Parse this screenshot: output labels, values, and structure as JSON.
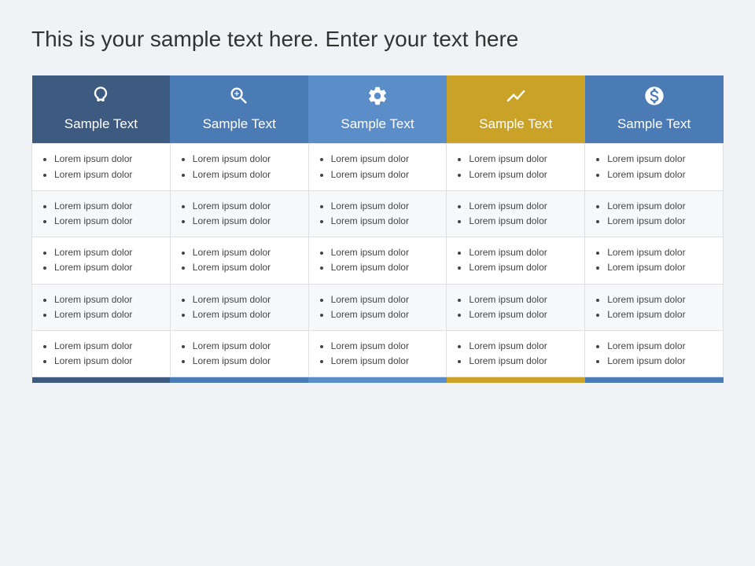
{
  "title": "This is your sample text here. Enter your text here",
  "columns": [
    {
      "id": "col1",
      "label": "Sample Text",
      "icon": "💡",
      "colorClass": "col-1",
      "bottomClass": "bc-1"
    },
    {
      "id": "col2",
      "label": "Sample Text",
      "icon": "🔍",
      "colorClass": "col-2",
      "bottomClass": "bc-2"
    },
    {
      "id": "col3",
      "label": "Sample Text",
      "icon": "⚙",
      "colorClass": "col-3",
      "bottomClass": "bc-3"
    },
    {
      "id": "col4",
      "label": "Sample Text",
      "icon": "📊",
      "colorClass": "col-4",
      "bottomClass": "bc-4"
    },
    {
      "id": "col5",
      "label": "Sample Text",
      "icon": "💰",
      "colorClass": "col-5",
      "bottomClass": "bc-5"
    }
  ],
  "rows": [
    {
      "cells": [
        [
          "Lorem ipsum dolor",
          "Lorem ipsum dolor"
        ],
        [
          "Lorem ipsum dolor",
          "Lorem ipsum dolor"
        ],
        [
          "Lorem ipsum dolor",
          "Lorem ipsum dolor"
        ],
        [
          "Lorem ipsum dolor",
          "Lorem ipsum dolor"
        ],
        [
          "Lorem ipsum dolor",
          "Lorem ipsum dolor"
        ]
      ]
    },
    {
      "cells": [
        [
          "Lorem ipsum dolor",
          "Lorem ipsum dolor"
        ],
        [
          "Lorem ipsum dolor",
          "Lorem ipsum dolor"
        ],
        [
          "Lorem ipsum dolor",
          "Lorem ipsum dolor"
        ],
        [
          "Lorem ipsum dolor",
          "Lorem ipsum dolor"
        ],
        [
          "Lorem ipsum dolor",
          "Lorem ipsum dolor"
        ]
      ]
    },
    {
      "cells": [
        [
          "Lorem ipsum dolor",
          "Lorem ipsum dolor"
        ],
        [
          "Lorem ipsum dolor",
          "Lorem ipsum dolor"
        ],
        [
          "Lorem ipsum dolor",
          "Lorem ipsum dolor"
        ],
        [
          "Lorem ipsum dolor",
          "Lorem ipsum dolor"
        ],
        [
          "Lorem ipsum dolor",
          "Lorem ipsum dolor"
        ]
      ]
    },
    {
      "cells": [
        [
          "Lorem ipsum dolor",
          "Lorem ipsum dolor"
        ],
        [
          "Lorem ipsum dolor",
          "Lorem ipsum dolor"
        ],
        [
          "Lorem ipsum dolor",
          "Lorem ipsum dolor"
        ],
        [
          "Lorem ipsum dolor",
          "Lorem ipsum dolor"
        ],
        [
          "Lorem ipsum dolor",
          "Lorem ipsum dolor"
        ]
      ]
    },
    {
      "cells": [
        [
          "Lorem ipsum dolor",
          "Lorem ipsum dolor"
        ],
        [
          "Lorem ipsum dolor",
          "Lorem ipsum dolor"
        ],
        [
          "Lorem ipsum dolor",
          "Lorem ipsum dolor"
        ],
        [
          "Lorem ipsum dolor",
          "Lorem ipsum dolor"
        ],
        [
          "Lorem ipsum dolor",
          "Lorem ipsum dolor"
        ]
      ]
    }
  ],
  "icons": {
    "col1": "&#128161;",
    "col2": "&#128269;",
    "col3": "&#9881;",
    "col4": "&#128202;",
    "col5": "&#128184;"
  }
}
